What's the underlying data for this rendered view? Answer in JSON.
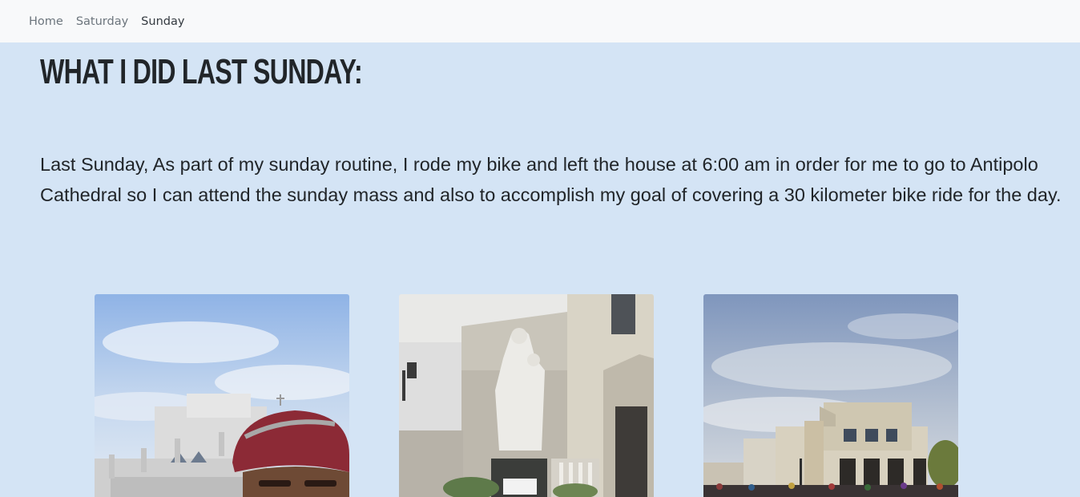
{
  "nav": {
    "links": [
      {
        "label": "Home",
        "active": false
      },
      {
        "label": "Saturday",
        "active": false
      },
      {
        "label": "Sunday",
        "active": true
      }
    ]
  },
  "page": {
    "title": "What I did last sunday:",
    "intro": "Last Sunday, As part of my sunday routine, I rode my bike and left the house at 6:00 am in order for me to go to Antipolo Cathedral so I can attend the sunday mass and also to accomplish my goal of covering a 30 kilometer bike ride for the day."
  },
  "colors": {
    "page_background": "#d4e4f5",
    "navbar_background": "#f8f9fa",
    "text": "#212529"
  },
  "gallery": {
    "photos": [
      {
        "subject": "selfie-with-helmet-in-front-of-cathedral"
      },
      {
        "subject": "statue-of-saint-joseph-with-child-at-cathedral"
      },
      {
        "subject": "cathedral-facade-under-cloudy-sky-with-crowd"
      }
    ]
  }
}
